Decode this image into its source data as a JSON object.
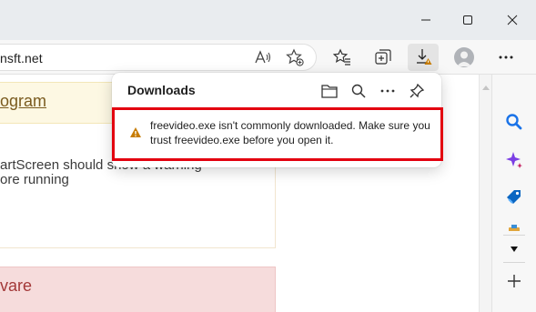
{
  "browser": {
    "address": {
      "url_fragment": "nsft.net"
    }
  },
  "page": {
    "yellow_card_title": "ogram",
    "white_card_text_line1": "artScreen should show a warning",
    "white_card_text_line2": "ore running",
    "red_card_title": "vare"
  },
  "downloads_flyout": {
    "title": "Downloads",
    "warning_line1": "freevideo.exe isn't commonly downloaded. Make sure you",
    "warning_line2": "trust freevideo.exe before you open it."
  },
  "colors": {
    "warning_border": "#e3000f",
    "warning_icon": "#c77c02",
    "search_accent": "#1a73e8",
    "copilot_accent": "#7b3fe4",
    "tag_accent": "#0a66c2"
  }
}
